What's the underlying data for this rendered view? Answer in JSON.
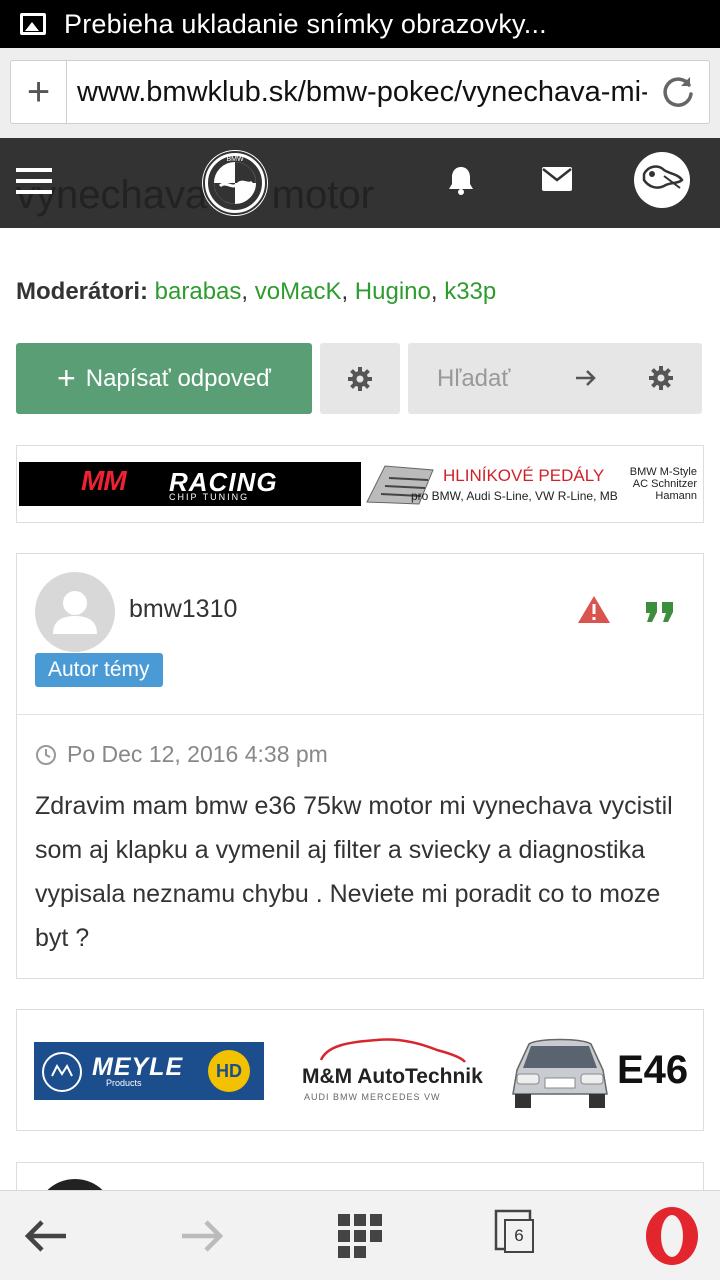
{
  "status_bar": {
    "text": "Prebieha ukladanie snímky obrazovky..."
  },
  "url_bar": {
    "url": "www.bmwklub.sk/bmw-pokec/vynechava-mi-motor"
  },
  "header": {
    "ghost_title": "vynechava mi motor",
    "logo_text": "BMW"
  },
  "moderators": {
    "label": "Moderátori:",
    "names": [
      "barabas",
      "voMacK",
      "Hugino",
      "k33p"
    ],
    "separator": ", "
  },
  "actions": {
    "reply_label": "Napísať odpoveď",
    "search_placeholder": "Hľadať"
  },
  "banner1": {
    "brand": "RACING",
    "brand_sub": "CHIP TUNING",
    "title": "HLINÍKOVÉ PEDÁLY",
    "subtitle": "pro BMW, Audi S-Line, VW R-Line, MB",
    "right": [
      "BMW M-Style",
      "AC Schnitzer",
      "Hamann"
    ]
  },
  "post": {
    "username": "bmw1310",
    "badge": "Autor témy",
    "date": "Po Dec 12, 2016 4:38 pm",
    "body": "Zdravim mam bmw e36 75kw motor mi vynechava vycistil som aj klapku a vymenil aj filter a sviecky a diagnostika vypisala neznamu chybu . Neviete mi poradit co to moze byt ?"
  },
  "banner2": {
    "meyle": "MEYLE",
    "meyle_sub": "Products",
    "meyle_hd": "HD",
    "mm_auto": "M&M AutoTechnik",
    "mm_auto_sub": "AUDI   BMW   MERCEDES   VW",
    "model": "E46"
  },
  "bottom_nav": {
    "tabs_count": "6"
  },
  "colors": {
    "header_bg": "#333333",
    "reply_button": "#5a9e76",
    "moderator_link": "#2e9b2e",
    "badge": "#4a9bd5",
    "warning": "#d9534f",
    "quote": "#3c8d3c",
    "opera_red": "#e3262d"
  }
}
